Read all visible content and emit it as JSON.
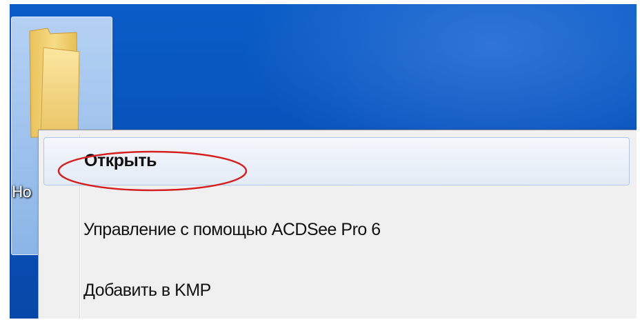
{
  "desktop": {
    "folder_label": "Но"
  },
  "context_menu": {
    "items": [
      {
        "label": "Открыть",
        "bold": true,
        "highlighted": true
      },
      {
        "label": "Управление с помощью ACDSee Pro 6"
      },
      {
        "label": "Добавить в KMP"
      }
    ]
  },
  "colors": {
    "desktop_blue": "#0752bb",
    "menu_background": "#f0f0f0",
    "annotation_red": "#d42020"
  },
  "icons": {
    "folder": "folder-icon"
  }
}
